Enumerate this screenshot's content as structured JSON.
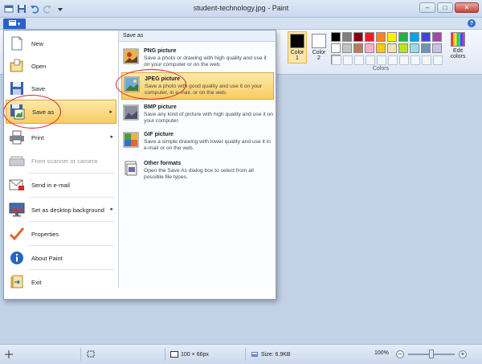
{
  "window": {
    "title": "student-technology.jpg - Paint",
    "minimize": "–",
    "maximize": "□",
    "close": "✕"
  },
  "tabs": {
    "file_tab_glyph": "▾"
  },
  "help": "?",
  "ribbon": {
    "color1_label": "Color 1",
    "color2_label": "Color 2",
    "edit_colors_label": "Edit colors",
    "group_label": "Colors",
    "color1_value": "#000000",
    "color2_value": "#ffffff",
    "palette_row1": [
      "#000000",
      "#7f7f7f",
      "#880015",
      "#ed1c24",
      "#ff7f27",
      "#fff200",
      "#22b14c",
      "#00a2e8",
      "#3f48cc",
      "#a349a4"
    ],
    "palette_row2": [
      "#ffffff",
      "#c3c3c3",
      "#b97a57",
      "#ffaec9",
      "#ffc90e",
      "#efe4b0",
      "#b5e61d",
      "#99d9ea",
      "#7092be",
      "#c8bfe7"
    ]
  },
  "file_menu": {
    "items": [
      {
        "label": "New",
        "icon": "new-document-icon"
      },
      {
        "label": "Open",
        "icon": "open-folder-icon"
      },
      {
        "label": "Save",
        "icon": "save-disk-icon"
      },
      {
        "label": "Save as",
        "icon": "save-as-icon",
        "submenu": true,
        "active": true
      },
      {
        "label": "Print",
        "icon": "printer-icon",
        "submenu": true
      },
      {
        "label": "From scanner or camera",
        "icon": "scanner-icon",
        "disabled": true
      },
      {
        "label": "Send in e-mail",
        "icon": "email-icon"
      },
      {
        "label": "Set as desktop background",
        "icon": "desktop-background-icon",
        "submenu": true
      },
      {
        "label": "Properties",
        "icon": "checkmark-icon"
      },
      {
        "label": "About Paint",
        "icon": "info-icon"
      },
      {
        "label": "Exit",
        "icon": "exit-icon"
      }
    ],
    "submenu_arrow": "▸",
    "save_as": {
      "header": "Save as",
      "options": [
        {
          "title": "PNG picture",
          "desc": "Save a photo or drawing with high quality and use it on your computer or on the web."
        },
        {
          "title": "JPEG picture",
          "desc": "Save a photo with good quality and use it on your computer, in e-mail, or on the web.",
          "active": true
        },
        {
          "title": "BMP picture",
          "desc": "Save any kind of picture with high quality and use it on your computer."
        },
        {
          "title": "GIF picture",
          "desc": "Save a simple drawing with lower quality and use it in e-mail or on the web."
        },
        {
          "title": "Other formats",
          "desc": "Open the Save As dialog box to select from all possible file types."
        }
      ]
    }
  },
  "status": {
    "dimensions": "100 × 66px",
    "size": "Size: 6.9KB",
    "zoom": "100%",
    "zoom_out": "−",
    "zoom_in": "+",
    "zoom_level": 0.5
  }
}
